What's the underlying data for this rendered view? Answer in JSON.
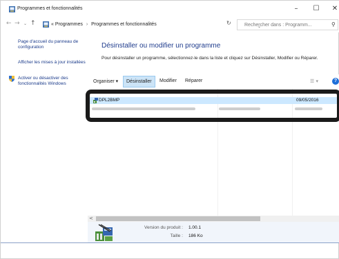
{
  "window": {
    "title": "Programmes et fonctionnalités",
    "minimize": "–",
    "maximize": "☐",
    "close": "✕"
  },
  "nav": {
    "back": "←",
    "forward": "→",
    "recent": "⌄",
    "up": "↑",
    "breadcrumb": [
      "« Programmes",
      "Programmes et fonctionnalités"
    ],
    "separator": "›",
    "dropdown": "⌄",
    "refresh": "↻",
    "search_placeholder": "Rechercher dans : Programm...",
    "search_glyph": "⚲"
  },
  "sidebar": {
    "items": [
      {
        "label": "Page d'accueil du panneau de configuration"
      },
      {
        "label": "Afficher les mises à jour installées"
      },
      {
        "label": "Activer ou désactiver des fonctionnalités Windows",
        "icon": "shield-icon"
      }
    ]
  },
  "main": {
    "title": "Désinstaller ou modifier un programme",
    "description": "Pour désinstaller un programme, sélectionnez-le dans la liste et cliquez sur Désinstaller, Modifier ou Réparer."
  },
  "toolbar": {
    "organize": "Organiser ▾",
    "uninstall": "Désinstaller",
    "modify": "Modifier",
    "repair": "Réparer",
    "views": "☰ ▾",
    "help": "?"
  },
  "programs": [
    {
      "name": "DPL2BMP",
      "date": "09/05/2016",
      "selected": true
    }
  ],
  "details": {
    "version_label": "Version du produit :",
    "version_value": "1.00.1",
    "size_label": "Taille :",
    "size_value": "186 Ko"
  },
  "scroll": {
    "left_arrow": "<"
  },
  "colors": {
    "link": "#1a3a8a",
    "title": "#1e3b8c",
    "selection": "#cce8ff",
    "highlight_frame": "#1a1a1a",
    "details_bg": "#f1f5fb"
  }
}
